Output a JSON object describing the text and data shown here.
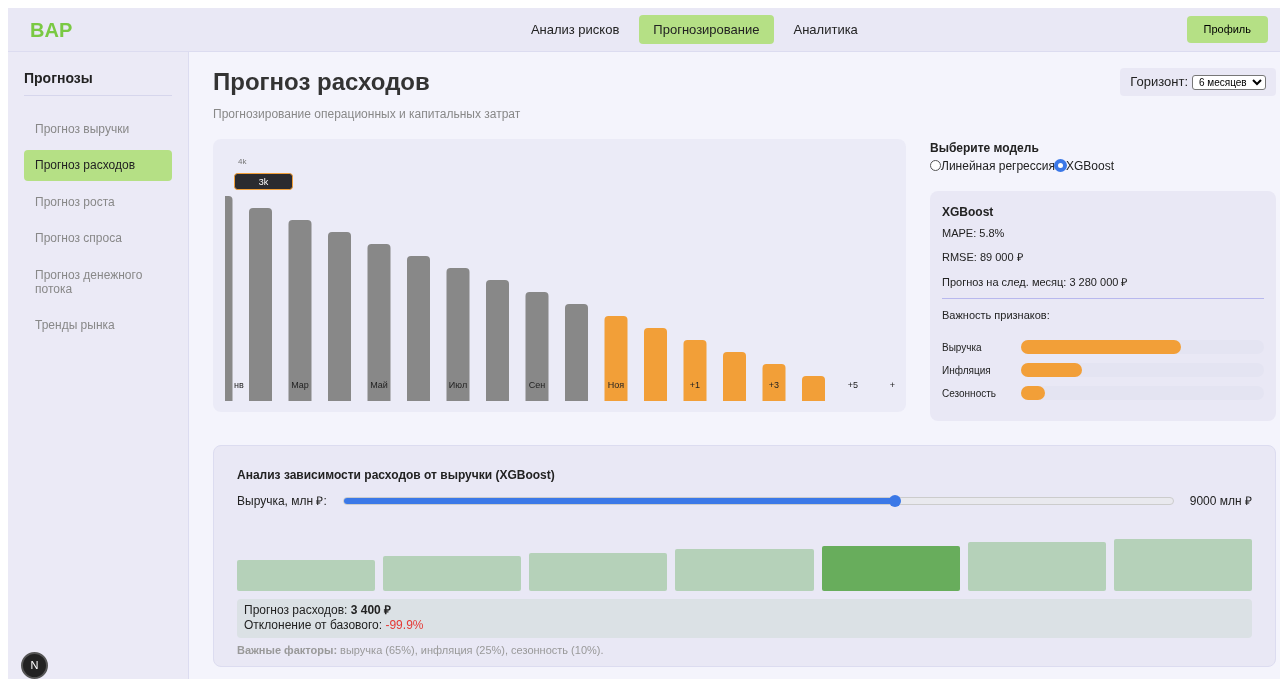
{
  "brand": "BAP",
  "nav": [
    {
      "label": "Анализ рисков",
      "selected": false
    },
    {
      "label": "Прогнозирование",
      "selected": true
    },
    {
      "label": "Аналитика",
      "selected": false
    }
  ],
  "profile_button": "Профиль",
  "sidebar": {
    "title": "Прогнозы",
    "items": [
      {
        "label": "Прогноз выручки",
        "selected": false
      },
      {
        "label": "Прогноз расходов",
        "selected": true
      },
      {
        "label": "Прогноз роста",
        "selected": false
      },
      {
        "label": "Прогноз спроса",
        "selected": false
      },
      {
        "label": "Прогноз денежного потока",
        "selected": false
      },
      {
        "label": "Тренды рынка",
        "selected": false
      }
    ]
  },
  "page": {
    "title": "Прогноз расходов",
    "subtitle": "Прогнозирование операционных и капитальных затрат",
    "horizon_label": "Горизонт:",
    "horizon_value": "6 месяцев"
  },
  "chart": {
    "tick_label": "4k",
    "tooltip": "3k",
    "slots": [
      {
        "kind": "actual",
        "label": "нв"
      },
      {
        "kind": "actual"
      },
      {
        "kind": "actual",
        "label": "Мар"
      },
      {
        "kind": "actual"
      },
      {
        "kind": "actual",
        "label": "Май"
      },
      {
        "kind": "actual"
      },
      {
        "kind": "actual",
        "label": "Июл"
      },
      {
        "kind": "actual"
      },
      {
        "kind": "actual",
        "label": "Сен"
      },
      {
        "kind": "actual"
      },
      {
        "kind": "forecast",
        "label": "Ноя"
      },
      {
        "kind": "forecast"
      },
      {
        "kind": "forecast",
        "label": "+1"
      },
      {
        "kind": "forecast"
      },
      {
        "kind": "forecast",
        "label": "+3"
      },
      {
        "kind": "forecast"
      },
      {
        "kind": "empty",
        "label": "+5"
      },
      {
        "kind": "empty",
        "label": "+"
      }
    ]
  },
  "model_select": {
    "title": "Выберите модель",
    "options": [
      {
        "label": "Линейная регрессия",
        "selected": false
      },
      {
        "label": "XGBoost",
        "selected": true
      }
    ]
  },
  "model_card": {
    "name": "XGBoost",
    "metrics": [
      "MAPE: 5.8%",
      "RMSE: 89 000 ₽",
      "Прогноз на след. месяц: 3 280 000 ₽"
    ],
    "importance_title": "Важность признаков:",
    "features": [
      {
        "name": "Выручка",
        "level": 0.66
      },
      {
        "name": "Инфляция",
        "level": 0.25
      },
      {
        "name": "Сезонность",
        "level": 0.1
      }
    ]
  },
  "analysis": {
    "title": "Анализ зависимости расходов от выручки (XGBoost)",
    "slider_label": "Выручка, млн ₽:",
    "slider": {
      "level": 0.665
    },
    "slider_reading": "9000 млн ₽",
    "blocks": [
      {
        "selected": false
      },
      {
        "selected": false
      },
      {
        "selected": false
      },
      {
        "selected": false
      },
      {
        "selected": true
      },
      {
        "selected": false
      },
      {
        "selected": false
      }
    ],
    "result_lines": [
      "Прогноз расходов: **3 400 ₽**"
    ],
    "deviation_label": "Отклонение от базового:",
    "deviation_value": "-99.9%",
    "factors": "**Важные факторы:** выручка (65%), инфляция (25%), сезонность (10%)."
  },
  "dev_badge": "N"
}
